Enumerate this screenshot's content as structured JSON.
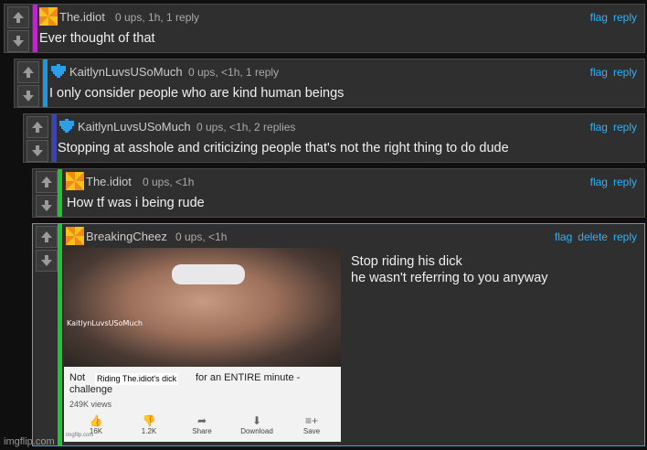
{
  "comments": [
    {
      "username": "The.idiot",
      "meta": "0 ups, 1h, 1 reply",
      "actions": [
        "flag",
        "reply"
      ],
      "text": "Ever thought of that",
      "stripe_color": "#b829c6",
      "avatar": "pinwheel-icon"
    },
    {
      "username": "KaitlynLuvsUSoMuch",
      "meta": "0 ups, <1h, 1 reply",
      "actions": [
        "flag",
        "reply"
      ],
      "text": "I only consider people who are kind human beings",
      "stripe_color": "#1f97e0",
      "avatar": "heart-icon"
    },
    {
      "username": "KaitlynLuvsUSoMuch",
      "meta": "0 ups, <1h, 2 replies",
      "actions": [
        "flag",
        "reply"
      ],
      "text": "Stopping at asshole and criticizing people that's not the right thing to do dude",
      "stripe_color": "#3b3fd1",
      "avatar": "heart-icon"
    },
    {
      "username": "The.idiot",
      "meta": "0 ups, <1h",
      "actions": [
        "flag",
        "reply"
      ],
      "text": "How tf was i being rude",
      "stripe_color": "#22c233",
      "avatar": "pinwheel-icon"
    },
    {
      "username": "BreakingCheez",
      "meta": "0 ups, <1h",
      "actions": [
        "flag",
        "delete",
        "reply"
      ],
      "text_lines": [
        "Stop riding his dick",
        "he wasn't referring to you anyway"
      ],
      "stripe_color": "#22c233",
      "avatar": "pinwheel-icon",
      "image": {
        "overlay_name": "KaitlynLuvsUSoMuch",
        "title_start": "Not",
        "title_tag": "Riding The.idiot's dick",
        "title_end": "for an ENTIRE minute -",
        "title_line2": "challenge",
        "views": "249K views",
        "buttons": [
          {
            "icon": "thumbs-up-icon",
            "label": "16K"
          },
          {
            "icon": "thumbs-down-icon",
            "label": "1.2K"
          },
          {
            "icon": "share-icon",
            "label": "Share"
          },
          {
            "icon": "download-icon",
            "label": "Download"
          },
          {
            "icon": "save-icon",
            "label": "Save"
          }
        ],
        "watermark": "imgflip.com"
      }
    }
  ],
  "footer": {
    "watermark": "imgflip.com"
  }
}
